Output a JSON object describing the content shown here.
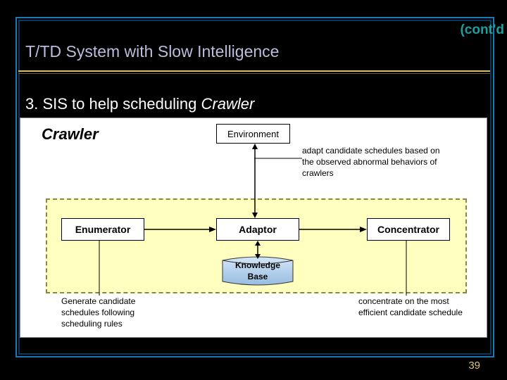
{
  "cont": "(cont'd",
  "title": "T/TD System with Slow Intelligence",
  "subtitle_prefix": "3. SIS to help scheduling ",
  "subtitle_em": "Crawler",
  "diagram": {
    "crawler_label": "Crawler",
    "environment": "Environment",
    "env_note": "adapt candidate schedules based on the observed abnormal behaviors of crawlers",
    "enumerator": "Enumerator",
    "adaptor": "Adaptor",
    "concentrator": "Concentrator",
    "kb": "Knowledge Base",
    "enum_note": "Generate candidate schedules following scheduling rules",
    "conc_note": "concentrate on the most efficient candidate schedule"
  },
  "page_number": "39"
}
